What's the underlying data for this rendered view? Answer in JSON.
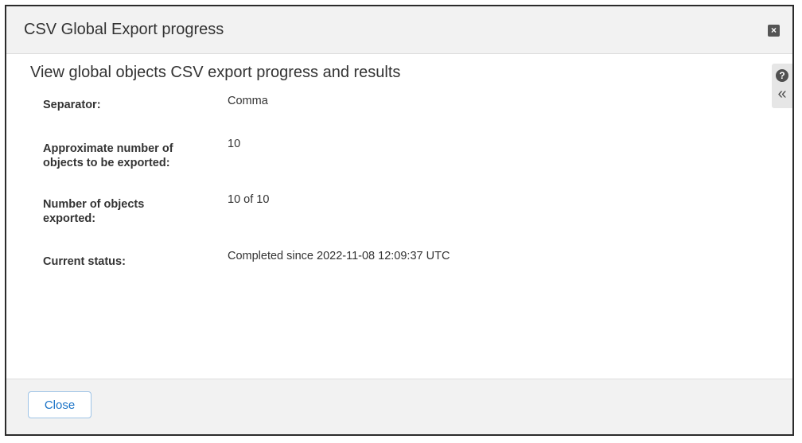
{
  "dialog": {
    "title": "CSV Global Export progress",
    "close_glyph": "×",
    "subtitle": "View global objects CSV export progress and results"
  },
  "side_tools": {
    "help_glyph": "?",
    "collapse_glyph": "«"
  },
  "fields": [
    {
      "label": "Separator:",
      "value": "Comma"
    },
    {
      "label": "Approximate number of objects to be exported:",
      "value": "10"
    },
    {
      "label": "Number of objects exported:",
      "value": "10 of 10"
    },
    {
      "label": "Current status:",
      "value": "Completed since 2022-11-08 12:09:37 UTC"
    }
  ],
  "footer": {
    "close_label": "Close"
  },
  "icons": {
    "close": "close-icon",
    "help": "help-icon",
    "collapse": "double-chevron-left-icon"
  },
  "colors": {
    "header_bg": "#f2f2f2",
    "footer_bg": "#f2f2f2",
    "text": "#333333",
    "button_text": "#1a73c7",
    "button_border": "#9ec3e6",
    "icon": "#505050"
  }
}
